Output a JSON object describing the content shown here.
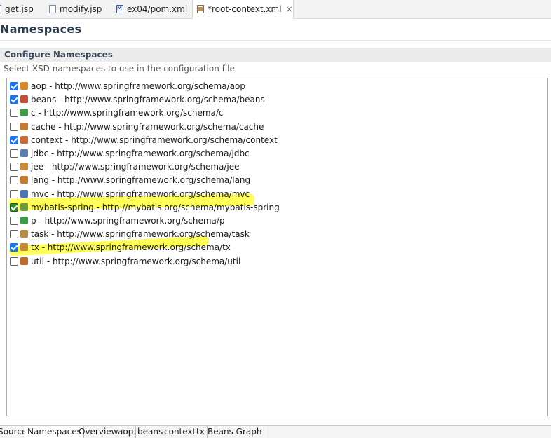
{
  "editor_tabs": [
    {
      "label": "get.jsp",
      "icon": "jsp-file-icon"
    },
    {
      "label": "modify.jsp",
      "icon": "jsp-file-icon"
    },
    {
      "label": "ex04/pom.xml",
      "icon": "maven-pom-icon"
    },
    {
      "label": "*root-context.xml",
      "icon": "spring-xml-icon",
      "close": "×"
    }
  ],
  "page_title": "Namespaces",
  "section": {
    "title": "Configure Namespaces",
    "description": "Select XSD namespaces to use in the configuration file"
  },
  "namespaces": [
    {
      "label": "aop - http://www.springframework.org/schema/aop",
      "checked": true,
      "icon_color": "#d4882a"
    },
    {
      "label": "beans - http://www.springframework.org/schema/beans",
      "checked": true,
      "icon_color": "#c0503a"
    },
    {
      "label": "c - http://www.springframework.org/schema/c",
      "checked": false,
      "icon_color": "#3f9a4a"
    },
    {
      "label": "cache - http://www.springframework.org/schema/cache",
      "checked": false,
      "icon_color": "#c47a30"
    },
    {
      "label": "context - http://www.springframework.org/schema/context",
      "checked": true,
      "icon_color": "#c96b3a"
    },
    {
      "label": "jdbc - http://www.springframework.org/schema/jdbc",
      "checked": false,
      "icon_color": "#5b7fb5"
    },
    {
      "label": "jee - http://www.springframework.org/schema/jee",
      "checked": false,
      "icon_color": "#c98a3a"
    },
    {
      "label": "lang - http://www.springframework.org/schema/lang",
      "checked": false,
      "icon_color": "#c57b2f"
    },
    {
      "label": "mvc - http://www.springframework.org/schema/mvc",
      "checked": false,
      "icon_color": "#4a74b8"
    },
    {
      "label": "mybatis-spring - http://mybatis.org/schema/mybatis-spring",
      "checked": true,
      "icon_color": "#6a9a3a"
    },
    {
      "label": "p - http://www.springframework.org/schema/p",
      "checked": false,
      "icon_color": "#3f9a4a"
    },
    {
      "label": "task - http://www.springframework.org/schema/task",
      "checked": false,
      "icon_color": "#b98a4a"
    },
    {
      "label": "tx - http://www.springframework.org/schema/tx",
      "checked": true,
      "icon_color": "#c5883a"
    },
    {
      "label": "util - http://www.springframework.org/schema/util",
      "checked": false,
      "icon_color": "#c06a2a"
    }
  ],
  "bottom_tabs": [
    "Source",
    "Namespaces",
    "Overview",
    "aop",
    "beans",
    "context",
    "tx",
    "Beans Graph"
  ],
  "colors": {
    "checkbox_checked": "#1a73e8",
    "highlight": "#ffff3a"
  }
}
